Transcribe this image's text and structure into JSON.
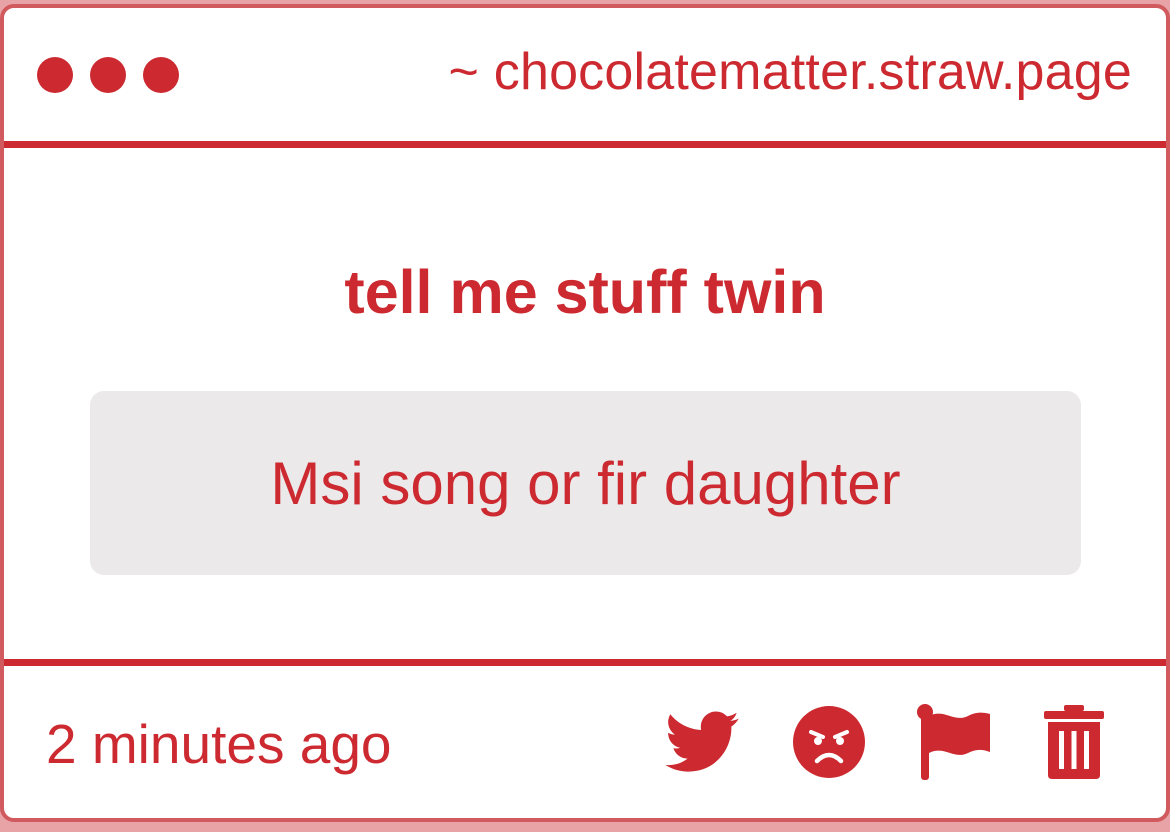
{
  "window": {
    "url": "~ chocolatematter.straw.page"
  },
  "question": {
    "text": "tell me stuff twin"
  },
  "answer": {
    "text": "Msi song or fir daughter"
  },
  "footer": {
    "timestamp": "2 minutes ago",
    "actions": [
      {
        "icon": "twitter-icon"
      },
      {
        "icon": "angry-face-icon"
      },
      {
        "icon": "flag-icon"
      },
      {
        "icon": "trash-icon"
      }
    ]
  },
  "colors": {
    "accent": "#cc2a30",
    "answer_background": "#ebe9ea",
    "outer_background": "#e8a3a6"
  }
}
